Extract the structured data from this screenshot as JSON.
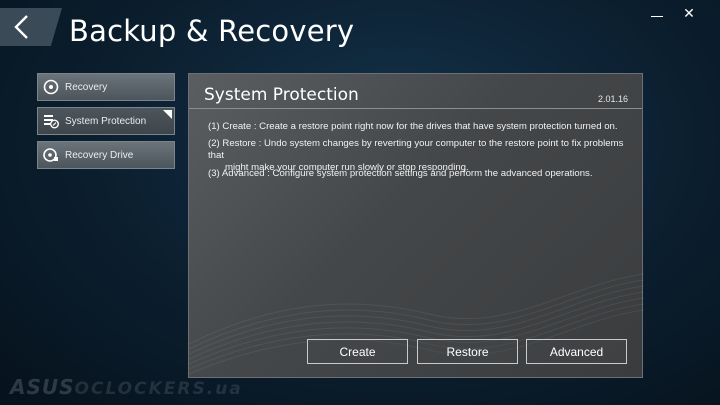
{
  "window": {
    "title": "Backup & Recovery",
    "minimize_label": "",
    "close_label": "✕"
  },
  "sidebar": {
    "items": [
      {
        "label": "Recovery",
        "icon": "disc-icon",
        "active": false
      },
      {
        "label": "System Protection",
        "icon": "shield-stack-icon",
        "active": true
      },
      {
        "label": "Recovery Drive",
        "icon": "drive-icon",
        "active": false
      }
    ]
  },
  "panel": {
    "title": "System Protection",
    "version": "2.01.16",
    "descriptions": {
      "create": "(1) Create : Create a restore point right now for the drives that have system protection turned on.",
      "restore_line1": "(2) Restore : Undo system changes by reverting  your computer to the restore point to fix problems that",
      "restore_line2": "might make your computer run slowly or stop responding.",
      "advanced": "(3) Advanced : Configure system protection settings and perform the advanced operations."
    },
    "buttons": {
      "create": "Create",
      "restore": "Restore",
      "advanced": "Advanced"
    }
  },
  "watermark": {
    "brand": "ASUS",
    "rest": "OCLOCKERS.ua"
  },
  "colors": {
    "background": "#0b1e2e",
    "panel": "#4a4d50",
    "accent": "#ffffff"
  }
}
